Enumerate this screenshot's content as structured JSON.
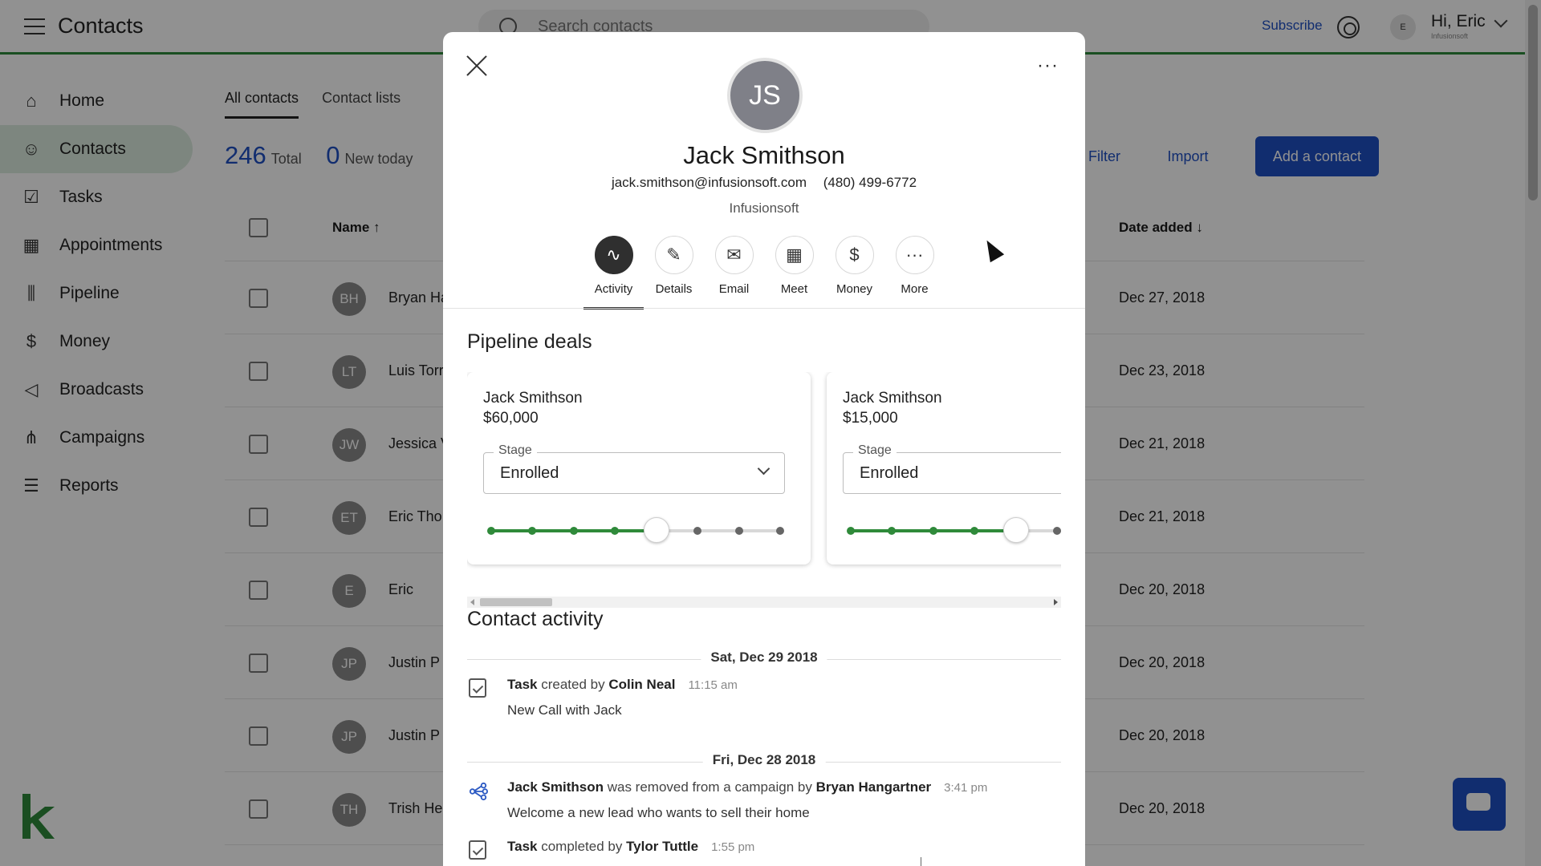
{
  "app": {
    "title": "Contacts",
    "search_placeholder": "Search contacts",
    "subscribe": "Subscribe",
    "user_initial": "E",
    "user_greeting": "Hi, Eric",
    "user_org": "Infusionsoft"
  },
  "sidebar": {
    "items": [
      {
        "label": "Home",
        "icon": "home-icon",
        "glyph": "⌂"
      },
      {
        "label": "Contacts",
        "icon": "person-icon",
        "glyph": "☺"
      },
      {
        "label": "Tasks",
        "icon": "clipboard-icon",
        "glyph": "☑"
      },
      {
        "label": "Appointments",
        "icon": "calendar-icon",
        "glyph": "▦"
      },
      {
        "label": "Pipeline",
        "icon": "pipeline-icon",
        "glyph": "⫼"
      },
      {
        "label": "Money",
        "icon": "money-icon",
        "glyph": "$"
      },
      {
        "label": "Broadcasts",
        "icon": "megaphone-icon",
        "glyph": "◁"
      },
      {
        "label": "Campaigns",
        "icon": "campaign-icon",
        "glyph": "⋔"
      },
      {
        "label": "Reports",
        "icon": "report-icon",
        "glyph": "☰"
      }
    ]
  },
  "contacts": {
    "tabs": [
      "All contacts",
      "Contact lists"
    ],
    "total_count": "246",
    "total_label": "Total",
    "new_count": "0",
    "new_label": "New today",
    "filter": "Filter",
    "import": "Import",
    "add": "Add a contact",
    "col_name": "Name ↑",
    "col_date": "Date added ↓",
    "rows": [
      {
        "initials": "BH",
        "name": "Bryan Ha",
        "date": "Dec 27, 2018"
      },
      {
        "initials": "LT",
        "name": "Luis Torr",
        "date": "Dec 23, 2018"
      },
      {
        "initials": "JW",
        "name": "Jessica V",
        "date": "Dec 21, 2018"
      },
      {
        "initials": "ET",
        "name": "Eric Tho",
        "date": "Dec 21, 2018"
      },
      {
        "initials": "E",
        "name": "Eric",
        "date": "Dec 20, 2018"
      },
      {
        "initials": "JP",
        "name": "Justin P",
        "date": "Dec 20, 2018"
      },
      {
        "initials": "JP",
        "name": "Justin P",
        "date": "Dec 20, 2018"
      },
      {
        "initials": "TH",
        "name": "Trish He",
        "date": "Dec 20, 2018"
      }
    ]
  },
  "modal": {
    "initials": "JS",
    "name": "Jack Smithson",
    "email": "jack.smithson@infusionsoft.com",
    "phone": "(480) 499-6772",
    "company": "Infusionsoft",
    "more": "···",
    "actions": [
      {
        "label": "Activity",
        "icon": "activity-icon",
        "glyph": "∿",
        "active": true
      },
      {
        "label": "Details",
        "icon": "person-edit-icon",
        "glyph": "✎",
        "active": false
      },
      {
        "label": "Email",
        "icon": "envelope-icon",
        "glyph": "✉",
        "active": false
      },
      {
        "label": "Meet",
        "icon": "calendar-icon",
        "glyph": "▦",
        "active": false
      },
      {
        "label": "Money",
        "icon": "dollar-icon",
        "glyph": "$",
        "active": false
      },
      {
        "label": "More",
        "icon": "more-icon",
        "glyph": "···",
        "active": false
      }
    ],
    "pipeline_title": "Pipeline deals",
    "deals": [
      {
        "name": "Jack Smithson",
        "value": "$60,000",
        "stage_label": "Stage",
        "stage": "Enrolled",
        "stage_index": 4,
        "stage_count": 8
      },
      {
        "name": "Jack Smithson",
        "value": "$15,000",
        "stage_label": "Stage",
        "stage": "Enrolled",
        "stage_index": 4,
        "stage_count": 8
      }
    ],
    "activity_title": "Contact activity",
    "days": [
      {
        "date": "Sat, Dec 29 2018",
        "items": [
          {
            "icon": "task-icon",
            "parts": [
              [
                "b",
                "Task"
              ],
              [
                "t",
                " created by "
              ],
              [
                "b",
                "Colin Neal"
              ]
            ],
            "time": "11:15 am",
            "detail": "New Call with Jack"
          }
        ]
      },
      {
        "date": "Fri, Dec 28 2018",
        "items": [
          {
            "icon": "campaign-icon",
            "parts": [
              [
                "b",
                "Jack Smithson"
              ],
              [
                "t",
                " was removed from a campaign by "
              ],
              [
                "b",
                "Bryan Hangartner"
              ]
            ],
            "time": "3:41 pm",
            "detail": "Welcome a new lead who wants to sell their home"
          },
          {
            "icon": "task-icon",
            "parts": [
              [
                "b",
                "Task"
              ],
              [
                "t",
                " completed by "
              ],
              [
                "b",
                "Tylor Tuttle"
              ]
            ],
            "time": "1:55 pm",
            "detail": ""
          }
        ]
      }
    ]
  },
  "colors": {
    "accent": "#1f4fc4",
    "brand_green": "#2f8a3a",
    "active_nav": "#dcebdf"
  }
}
